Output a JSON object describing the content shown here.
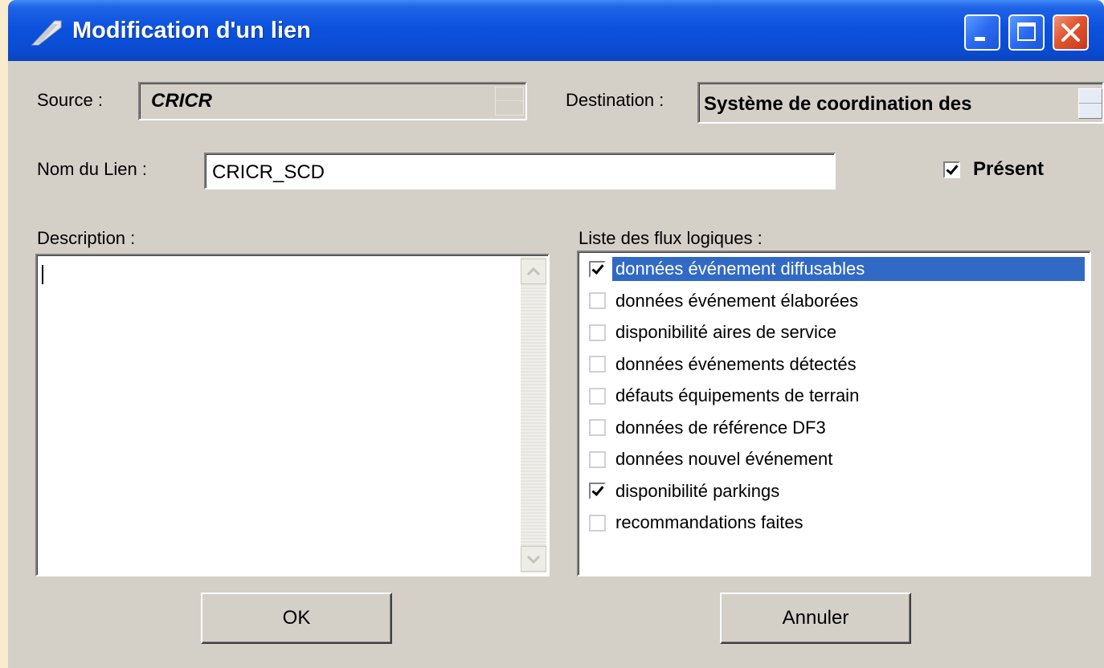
{
  "window": {
    "title": "Modification d'un lien"
  },
  "form": {
    "source_label": "Source :",
    "source_value": "CRICR",
    "destination_label": "Destination :",
    "destination_value": "Système de coordination des",
    "link_name_label": "Nom du Lien :",
    "link_name_value": "CRICR_SCD",
    "present_label": "Présent",
    "present_checked": true,
    "description_label": "Description :",
    "description_value": "",
    "flux_label": "Liste des flux logiques :"
  },
  "flux_items": [
    {
      "label": "données événement diffusables",
      "checked": true,
      "selected": true
    },
    {
      "label": "données événement élaborées",
      "checked": false,
      "selected": false
    },
    {
      "label": "disponibilité aires de service",
      "checked": false,
      "selected": false
    },
    {
      "label": "données événements détectés",
      "checked": false,
      "selected": false
    },
    {
      "label": "défauts équipements de terrain",
      "checked": false,
      "selected": false
    },
    {
      "label": "données de référence DF3",
      "checked": false,
      "selected": false
    },
    {
      "label": "données nouvel événement",
      "checked": false,
      "selected": false
    },
    {
      "label": "disponibilité parkings",
      "checked": true,
      "selected": false
    },
    {
      "label": "recommandations faites",
      "checked": false,
      "selected": false
    }
  ],
  "buttons": {
    "ok_label": "OK",
    "cancel_label": "Annuler"
  },
  "colors": {
    "titlebar": "#0a4fd6",
    "dialog_face": "#d4d0c8",
    "selection": "#316ac5",
    "close_button": "#e2552f"
  }
}
